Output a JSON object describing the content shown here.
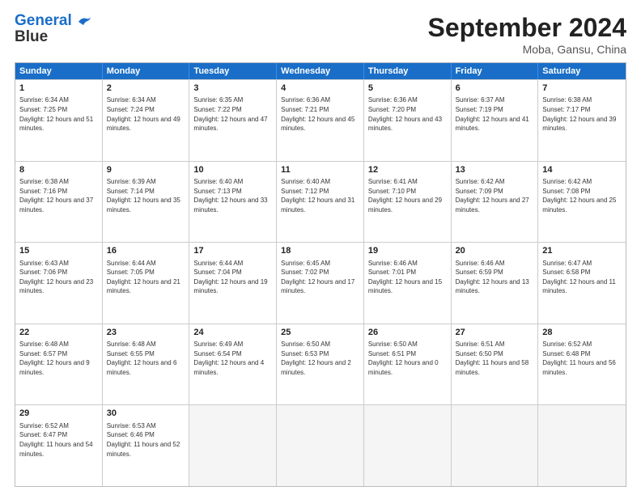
{
  "logo": {
    "line1": "General",
    "line2": "Blue"
  },
  "title": "September 2024",
  "location": "Moba, Gansu, China",
  "days": [
    "Sunday",
    "Monday",
    "Tuesday",
    "Wednesday",
    "Thursday",
    "Friday",
    "Saturday"
  ],
  "weeks": [
    [
      {
        "day": "1",
        "sunrise": "6:34 AM",
        "sunset": "7:25 PM",
        "daylight": "12 hours and 51 minutes."
      },
      {
        "day": "2",
        "sunrise": "6:34 AM",
        "sunset": "7:24 PM",
        "daylight": "12 hours and 49 minutes."
      },
      {
        "day": "3",
        "sunrise": "6:35 AM",
        "sunset": "7:22 PM",
        "daylight": "12 hours and 47 minutes."
      },
      {
        "day": "4",
        "sunrise": "6:36 AM",
        "sunset": "7:21 PM",
        "daylight": "12 hours and 45 minutes."
      },
      {
        "day": "5",
        "sunrise": "6:36 AM",
        "sunset": "7:20 PM",
        "daylight": "12 hours and 43 minutes."
      },
      {
        "day": "6",
        "sunrise": "6:37 AM",
        "sunset": "7:19 PM",
        "daylight": "12 hours and 41 minutes."
      },
      {
        "day": "7",
        "sunrise": "6:38 AM",
        "sunset": "7:17 PM",
        "daylight": "12 hours and 39 minutes."
      }
    ],
    [
      {
        "day": "8",
        "sunrise": "6:38 AM",
        "sunset": "7:16 PM",
        "daylight": "12 hours and 37 minutes."
      },
      {
        "day": "9",
        "sunrise": "6:39 AM",
        "sunset": "7:14 PM",
        "daylight": "12 hours and 35 minutes."
      },
      {
        "day": "10",
        "sunrise": "6:40 AM",
        "sunset": "7:13 PM",
        "daylight": "12 hours and 33 minutes."
      },
      {
        "day": "11",
        "sunrise": "6:40 AM",
        "sunset": "7:12 PM",
        "daylight": "12 hours and 31 minutes."
      },
      {
        "day": "12",
        "sunrise": "6:41 AM",
        "sunset": "7:10 PM",
        "daylight": "12 hours and 29 minutes."
      },
      {
        "day": "13",
        "sunrise": "6:42 AM",
        "sunset": "7:09 PM",
        "daylight": "12 hours and 27 minutes."
      },
      {
        "day": "14",
        "sunrise": "6:42 AM",
        "sunset": "7:08 PM",
        "daylight": "12 hours and 25 minutes."
      }
    ],
    [
      {
        "day": "15",
        "sunrise": "6:43 AM",
        "sunset": "7:06 PM",
        "daylight": "12 hours and 23 minutes."
      },
      {
        "day": "16",
        "sunrise": "6:44 AM",
        "sunset": "7:05 PM",
        "daylight": "12 hours and 21 minutes."
      },
      {
        "day": "17",
        "sunrise": "6:44 AM",
        "sunset": "7:04 PM",
        "daylight": "12 hours and 19 minutes."
      },
      {
        "day": "18",
        "sunrise": "6:45 AM",
        "sunset": "7:02 PM",
        "daylight": "12 hours and 17 minutes."
      },
      {
        "day": "19",
        "sunrise": "6:46 AM",
        "sunset": "7:01 PM",
        "daylight": "12 hours and 15 minutes."
      },
      {
        "day": "20",
        "sunrise": "6:46 AM",
        "sunset": "6:59 PM",
        "daylight": "12 hours and 13 minutes."
      },
      {
        "day": "21",
        "sunrise": "6:47 AM",
        "sunset": "6:58 PM",
        "daylight": "12 hours and 11 minutes."
      }
    ],
    [
      {
        "day": "22",
        "sunrise": "6:48 AM",
        "sunset": "6:57 PM",
        "daylight": "12 hours and 9 minutes."
      },
      {
        "day": "23",
        "sunrise": "6:48 AM",
        "sunset": "6:55 PM",
        "daylight": "12 hours and 6 minutes."
      },
      {
        "day": "24",
        "sunrise": "6:49 AM",
        "sunset": "6:54 PM",
        "daylight": "12 hours and 4 minutes."
      },
      {
        "day": "25",
        "sunrise": "6:50 AM",
        "sunset": "6:53 PM",
        "daylight": "12 hours and 2 minutes."
      },
      {
        "day": "26",
        "sunrise": "6:50 AM",
        "sunset": "6:51 PM",
        "daylight": "12 hours and 0 minutes."
      },
      {
        "day": "27",
        "sunrise": "6:51 AM",
        "sunset": "6:50 PM",
        "daylight": "11 hours and 58 minutes."
      },
      {
        "day": "28",
        "sunrise": "6:52 AM",
        "sunset": "6:48 PM",
        "daylight": "11 hours and 56 minutes."
      }
    ],
    [
      {
        "day": "29",
        "sunrise": "6:52 AM",
        "sunset": "6:47 PM",
        "daylight": "11 hours and 54 minutes."
      },
      {
        "day": "30",
        "sunrise": "6:53 AM",
        "sunset": "6:46 PM",
        "daylight": "11 hours and 52 minutes."
      },
      null,
      null,
      null,
      null,
      null
    ]
  ]
}
